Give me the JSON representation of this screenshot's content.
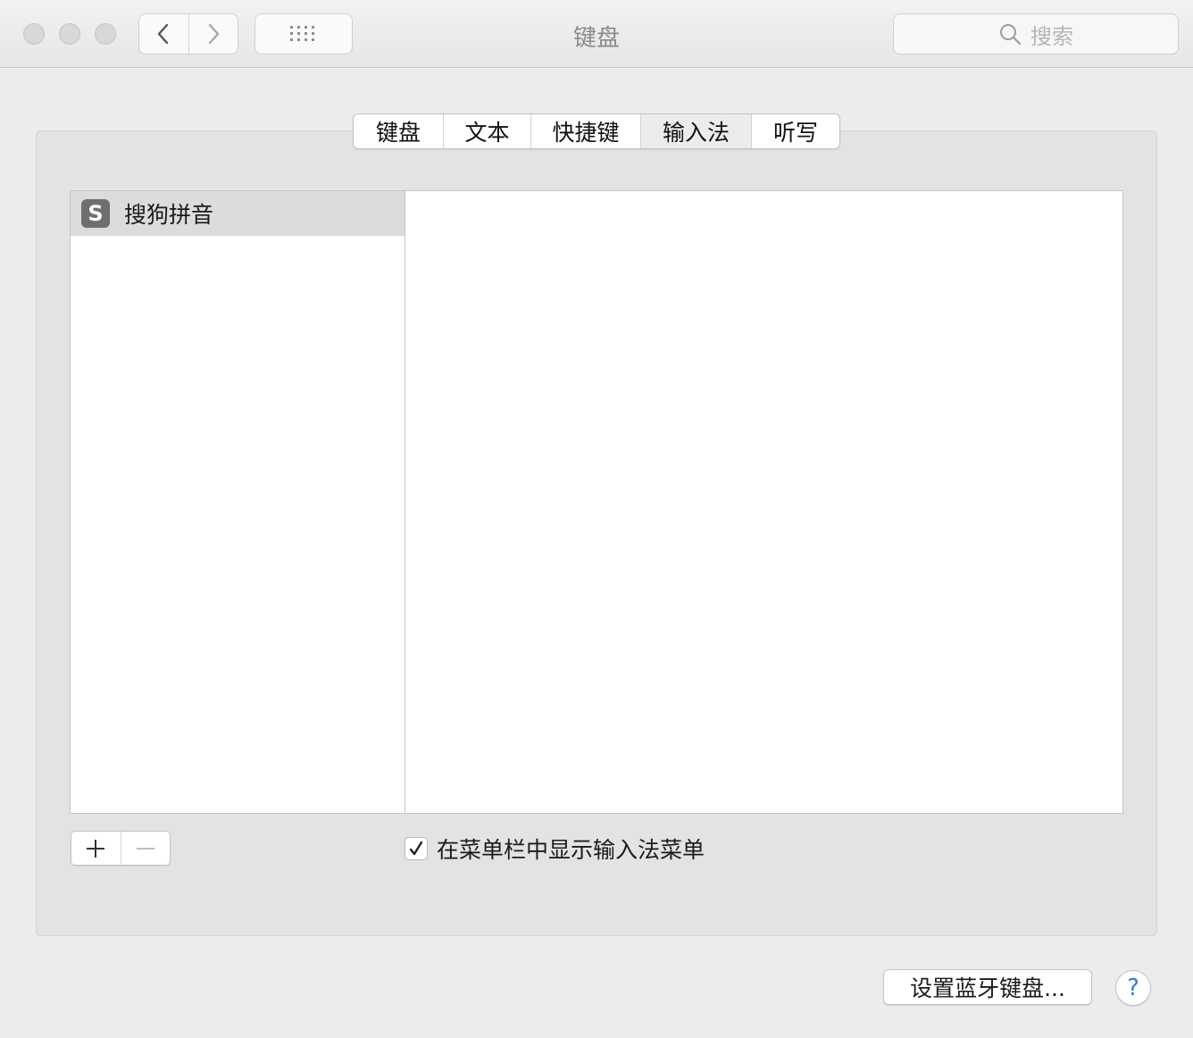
{
  "window": {
    "title": "键盘"
  },
  "toolbar": {
    "search_placeholder": "搜索"
  },
  "tabs": [
    {
      "label": "键盘",
      "selected": false
    },
    {
      "label": "文本",
      "selected": false
    },
    {
      "label": "快捷键",
      "selected": false
    },
    {
      "label": "输入法",
      "selected": true
    },
    {
      "label": "听写",
      "selected": false
    }
  ],
  "input_sources": [
    {
      "label": "搜狗拼音",
      "icon": "sogou-icon",
      "icon_glyph": "S",
      "selected": true
    }
  ],
  "options": {
    "show_input_menu_label": "在菜单栏中显示输入法菜单",
    "show_input_menu_checked": true
  },
  "footer": {
    "bluetooth_button": "设置蓝牙键盘...",
    "help_glyph": "?"
  },
  "colors": {
    "accent": "#2a7de1"
  }
}
